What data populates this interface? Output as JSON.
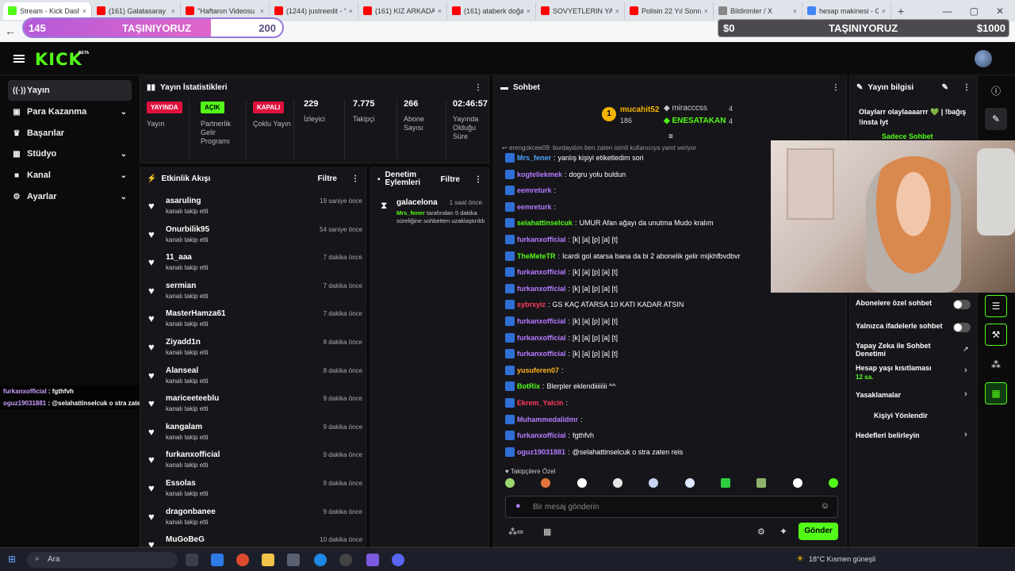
{
  "browser": {
    "tabs": [
      {
        "label": "Stream - Kick Dashboard",
        "color": "#53fc18"
      },
      {
        "label": "(161) Galatasaray",
        "color": "#ff0000"
      },
      {
        "label": "\"Haftanın Videosu G",
        "color": "#ff0000"
      },
      {
        "label": "(1244) justreedit - Yo",
        "color": "#ff0000"
      },
      {
        "label": "(161) KIZ ARKADAŞIM",
        "color": "#ff0000"
      },
      {
        "label": "(161) ataberk doğan",
        "color": "#ff0000"
      },
      {
        "label": "SOVYETLERIN YARAT",
        "color": "#ff0000"
      },
      {
        "label": "Polisin 22 Yıl Sonra B",
        "color": "#ff0000"
      },
      {
        "label": "Bildirimler / X",
        "color": "#888888"
      },
      {
        "label": "hesap makinesi - Goo",
        "color": "#4285f4"
      }
    ]
  },
  "overlay": {
    "left_value": "145",
    "center_text": "TAŞINIYORUZ",
    "right_value": "200",
    "progress": 0.725,
    "money_left": "$0",
    "money_center": "TAŞINIYORUZ",
    "money_right": "$1000"
  },
  "brand": {
    "logo": "KICK",
    "tag": "BETA"
  },
  "sidebar": {
    "items": [
      {
        "label": "Yayın",
        "icon": "broadcast-icon"
      },
      {
        "label": "Para Kazanma",
        "icon": "money-icon"
      },
      {
        "label": "Başarılar",
        "icon": "trophy-icon"
      },
      {
        "label": "Stüdyo",
        "icon": "studio-icon"
      },
      {
        "label": "Kanal",
        "icon": "channel-icon"
      },
      {
        "label": "Ayarlar",
        "icon": "gear-icon"
      }
    ]
  },
  "stats": {
    "title": "Yayın İstatistikleri",
    "live_badge": "YAYINDA",
    "live_label": "Yayın",
    "partner_badge": "AÇIK",
    "partner_label": "Partnerlik Gelir Programı",
    "slow_badge": "KAPALI",
    "slow_label": "Çoklu Yayın",
    "viewers": "229",
    "viewers_label": "İzleyici",
    "followers": "7.775",
    "followers_label": "Takipçi",
    "subs": "266",
    "subs_label": "Abone Sayısı",
    "uptime": "02:46:57",
    "uptime_label": "Yayında Olduğu Süre"
  },
  "feed": {
    "title": "Etkinlik Akışı",
    "filter": "Filtre",
    "items": [
      {
        "name": "asaruling",
        "sub": "kanalı takip etti",
        "time": "19 saniye önce"
      },
      {
        "name": "Onurbilik95",
        "sub": "kanalı takip etti",
        "time": "54 saniye önce"
      },
      {
        "name": "11_aaa",
        "sub": "kanalı takip etti",
        "time": "7 dakika önce"
      },
      {
        "name": "sermian",
        "sub": "kanalı takip etti",
        "time": "7 dakika önce"
      },
      {
        "name": "MasterHamza61",
        "sub": "kanalı takip etti",
        "time": "7 dakika önce"
      },
      {
        "name": "Ziyadd1n",
        "sub": "kanalı takip etti",
        "time": "8 dakika önce"
      },
      {
        "name": "Alanseal",
        "sub": "kanalı takip etti",
        "time": "8 dakika önce"
      },
      {
        "name": "mariceeteeblu",
        "sub": "kanalı takip etti",
        "time": "9 dakika önce"
      },
      {
        "name": "kangalam",
        "sub": "kanalı takip etti",
        "time": "9 dakika önce"
      },
      {
        "name": "furkanxofficial",
        "sub": "kanalı takip etti",
        "time": "9 dakika önce"
      },
      {
        "name": "Essolas",
        "sub": "kanalı takip etti",
        "time": "9 dakika önce"
      },
      {
        "name": "dragonbanee",
        "sub": "kanalı takip etti",
        "time": "9 dakika önce"
      },
      {
        "name": "MuGoBeG",
        "sub": "",
        "time": "10 dakika önce"
      }
    ]
  },
  "mod": {
    "title": "Denetim Eylemleri",
    "filter": "Filtre",
    "user": "galacelona",
    "time": "1 saat önce",
    "actor": "Mrs_fener",
    "text": "tarafından 5 dakika süreliğine sohbetten uzaklaştırıldı"
  },
  "chat": {
    "title": "Sohbet",
    "top1_name": "mucahit52",
    "top1_count": "186",
    "top2_name": "miracccss",
    "top2_count": "4",
    "top3_name": "ENESATAKAN",
    "top3_count": "4",
    "reply_hint": "erengokcee09: burdaydım ben zaten isimli kullanıcıya yanıt veriyor",
    "messages": [
      {
        "user": "Mrs_fener",
        "color": "#4ea3ff",
        "text": "yanlış kişiyi etiketledim sori"
      },
      {
        "user": "kogteliekmek",
        "color": "#b57bff",
        "text": "dogru yolu buldun"
      },
      {
        "user": "eemreturk",
        "color": "#b57bff",
        "text": ""
      },
      {
        "user": "eemreturk",
        "color": "#b57bff",
        "text": ""
      },
      {
        "user": "selahattinselcuk",
        "color": "#53fc18",
        "text": "UMUR Afan ağayı da unutma Mudo kralım"
      },
      {
        "user": "furkanxofficial",
        "color": "#b57bff",
        "text": "[k] [a] [p] [a] [t]"
      },
      {
        "user": "TheMeteTR",
        "color": "#53fc18",
        "text": "Icardi gol atarsa bana da bi 2 abonelik gelir mijkhfbvdbvr"
      },
      {
        "user": "furkanxofficial",
        "color": "#b57bff",
        "text": "[k] [a] [p] [a] [t]"
      },
      {
        "user": "furkanxofficial",
        "color": "#b57bff",
        "text": "[k] [a] [p] [a] [t]"
      },
      {
        "user": "sybrxyiz",
        "color": "#ff3b5c",
        "text": "GS KAÇ ATARSA 10 KATI KADAR ATSIN"
      },
      {
        "user": "furkanxofficial",
        "color": "#b57bff",
        "text": "[k] [a] [p] [a] [t]"
      },
      {
        "user": "furkanxofficial",
        "color": "#b57bff",
        "text": "[k] [a] [p] [a] [t]"
      },
      {
        "user": "furkanxofficial",
        "color": "#b57bff",
        "text": "[k] [a] [p] [a] [t]"
      },
      {
        "user": "yusuferen07",
        "color": "#ffb020",
        "text": ""
      },
      {
        "user": "BotRix",
        "color": "#53fc18",
        "text": "Blerpler eklendiiiiiiii ^^"
      },
      {
        "user": "Ekrem_Yalcin",
        "color": "#ff3b5c",
        "text": ""
      },
      {
        "user": "Muhammedalidmr",
        "color": "#b57bff",
        "text": ""
      },
      {
        "user": "furkanxofficial",
        "color": "#b57bff",
        "text": "fgthfvh"
      },
      {
        "user": "oguz19031881",
        "color": "#b57bff",
        "text": "@selahattinselcuk o stra zaten reis"
      }
    ],
    "emote_section": "Takipçilere Özel",
    "placeholder": "Bir mesaj gönderin",
    "send": "Gönder"
  },
  "info": {
    "title": "Yayın bilgisi",
    "stream_title": "Olaylarr olaylaaaarrr 💚 | !bağış !insta lyt",
    "chat_mode": "Sadece Sohbet",
    "subs_only": "Abonelere özel sohbet",
    "emotes_only": "Yalnızca ifadelerle sohbet",
    "ai_mod": "Yapay Zeka ile Sohbet Denetimi",
    "account_age": "Hesap yaşı kısıtlaması",
    "account_age_val": "12 sa.",
    "banned": "Yasaklamalar",
    "redirect": "Kişiyi Yönlendir",
    "goals": "Hedefleri belirleyin"
  },
  "overlay_chat": [
    {
      "user": "furkanxofficial",
      "text": "fgthfvh"
    },
    {
      "user": "oguz19031881",
      "text": "@selahattinselcuk o stra zaten reis"
    }
  ],
  "taskbar": {
    "search": "Ara",
    "weather": "18°C  Kısmen güneşli"
  }
}
